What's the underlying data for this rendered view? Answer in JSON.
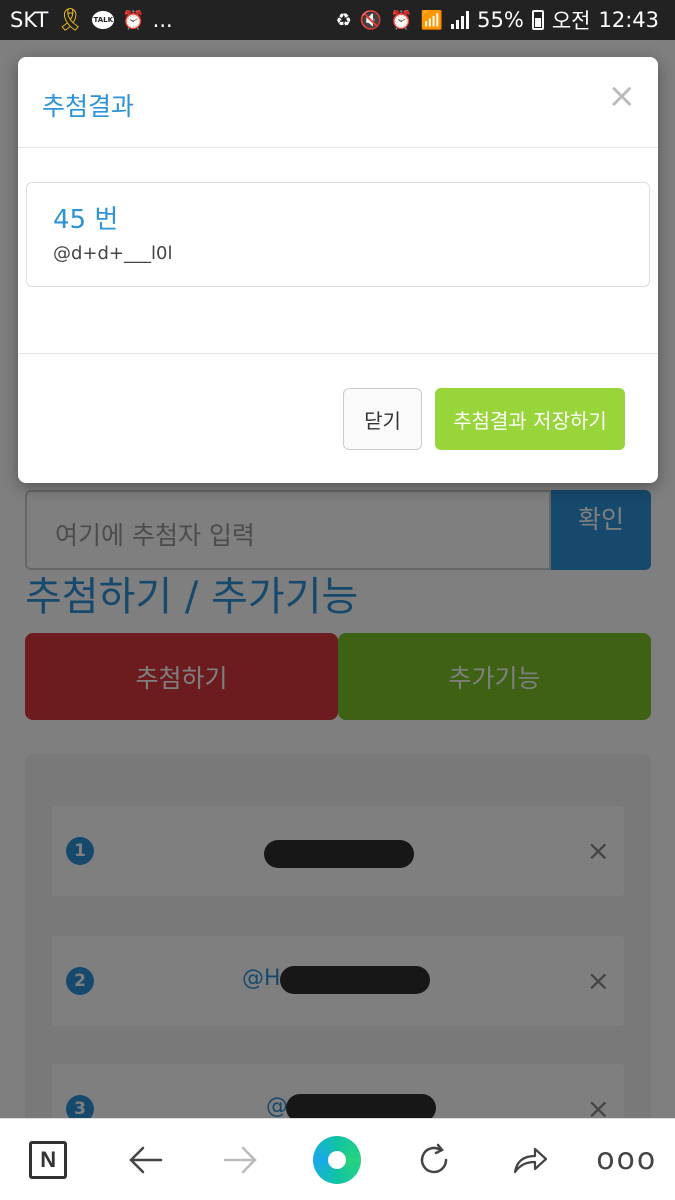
{
  "status_bar": {
    "carrier": "SKT",
    "talk_badge": "TALK",
    "more": "...",
    "battery": "55%",
    "time_prefix": "오전",
    "time": "12:43"
  },
  "modal": {
    "title": "추첨결과",
    "close_glyph": "×",
    "result_number": "45 번",
    "result_handle": "@d+d+___l0l",
    "close_button": "닫기",
    "save_button": "추첨결과 저장하기"
  },
  "background": {
    "entry_placeholder": "여기에 추첨자 입력",
    "entry_button": "확인",
    "section_title": "추첨하기 / 추가기능",
    "draw_button": "추첨하기",
    "extra_button": "추가기능",
    "list": [
      {
        "num": "1",
        "prefix": ""
      },
      {
        "num": "2",
        "prefix": "@H"
      },
      {
        "num": "3",
        "prefix": "@"
      }
    ],
    "remove_glyph": "×"
  },
  "toolbar": {
    "home_logo": "N",
    "more": "ooo"
  },
  "colors": {
    "accent_blue": "#2d93d9",
    "save_green": "#97d53a",
    "draw_red": "#d9363e",
    "extra_green": "#7dc226"
  },
  "icons": [
    "ribbon-icon",
    "talk-icon",
    "alarm-icon",
    "battery-saver-icon",
    "mute-icon",
    "wifi-icon",
    "signal-icon",
    "battery-icon",
    "back-arrow-icon",
    "forward-arrow-icon",
    "refresh-icon",
    "share-icon"
  ]
}
